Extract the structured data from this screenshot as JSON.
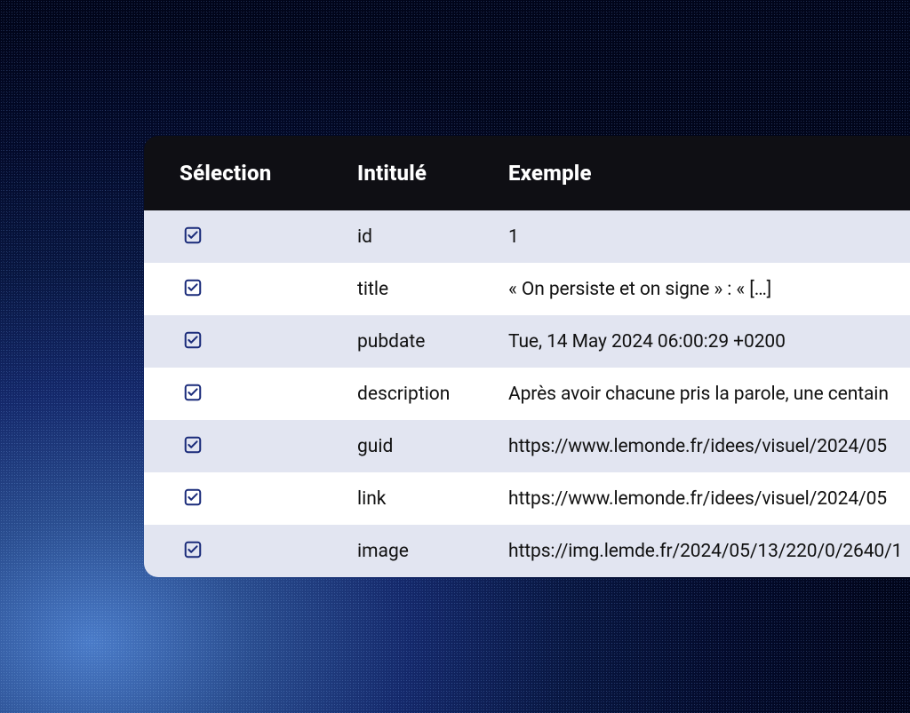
{
  "columns": {
    "selection": "Sélection",
    "label": "Intitulé",
    "example": "Exemple"
  },
  "rows": [
    {
      "label": "id",
      "example": "1"
    },
    {
      "label": "title",
      "example": "« On persiste et on signe » : « […]"
    },
    {
      "label": "pubdate",
      "example": "Tue, 14 May 2024 06:00:29 +0200"
    },
    {
      "label": "description",
      "example": "Après avoir chacune pris la parole, une centain"
    },
    {
      "label": "guid",
      "example": "https://www.lemonde.fr/idees/visuel/2024/05"
    },
    {
      "label": "link",
      "example": "https://www.lemonde.fr/idees/visuel/2024/05"
    },
    {
      "label": "image",
      "example": "https://img.lemde.fr/2024/05/13/220/0/2640/1"
    }
  ]
}
